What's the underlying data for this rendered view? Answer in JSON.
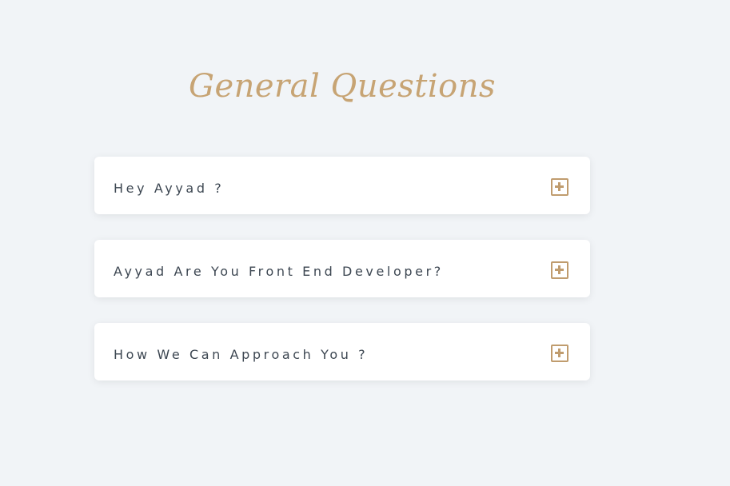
{
  "page": {
    "background_color": "#f1f4f7"
  },
  "faq": {
    "title": "General Questions",
    "title_color": "#c7a474",
    "icon_color": "#c09c6e",
    "text_color": "#3d4752",
    "items": [
      {
        "question": "Hey Ayyad ?",
        "expanded": false,
        "icon": "plus-square-icon"
      },
      {
        "question": "Ayyad Are You Front End Developer?",
        "expanded": false,
        "icon": "plus-square-icon"
      },
      {
        "question": "How We Can Approach You ?",
        "expanded": false,
        "icon": "plus-square-icon"
      }
    ]
  }
}
